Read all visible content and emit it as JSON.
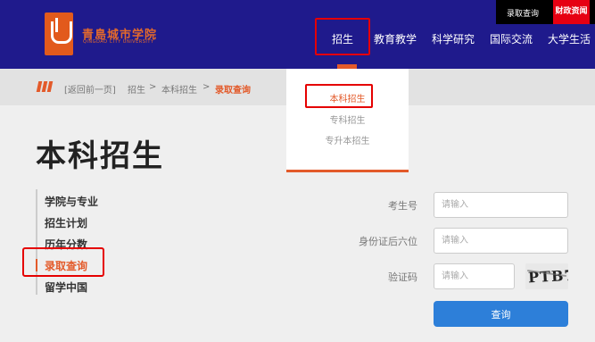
{
  "header": {
    "brand_cn": "青島城市学院",
    "brand_en": "QINGDAO CITY UNIVERSITY",
    "top_links": {
      "lookup": "录取查询",
      "separator": "|",
      "finance": "财政资闻"
    },
    "nav": [
      {
        "label": "招生"
      },
      {
        "label": "教育教学"
      },
      {
        "label": "科学研究"
      },
      {
        "label": "国际交流"
      },
      {
        "label": "大学生活"
      }
    ]
  },
  "dropdown": {
    "items": [
      {
        "label": "本科招生"
      },
      {
        "label": "专科招生"
      },
      {
        "label": "专升本招生"
      }
    ]
  },
  "breadcrumb": {
    "back": "[返回前一页]",
    "items": [
      "招生",
      "本科招生"
    ],
    "separator": ">",
    "current": "录取查询"
  },
  "page_title": "本科招生",
  "sidebar": {
    "items": [
      {
        "label": "学院与专业"
      },
      {
        "label": "招生计划"
      },
      {
        "label": "历年分数"
      },
      {
        "label": "录取查询"
      },
      {
        "label": "留学中国"
      }
    ]
  },
  "form": {
    "exam_number": {
      "label": "考生号",
      "placeholder": "请输入"
    },
    "id_last6": {
      "label": "身份证后六位",
      "placeholder": "请输入"
    },
    "captcha": {
      "label": "验证码",
      "placeholder": "请输入",
      "image_text": "PTB7"
    },
    "submit_label": "查询"
  },
  "colors": {
    "header_bg": "#1f1a8c",
    "accent": "#e35a2a",
    "highlight_border": "#e50000",
    "button": "#2d7fd9"
  }
}
